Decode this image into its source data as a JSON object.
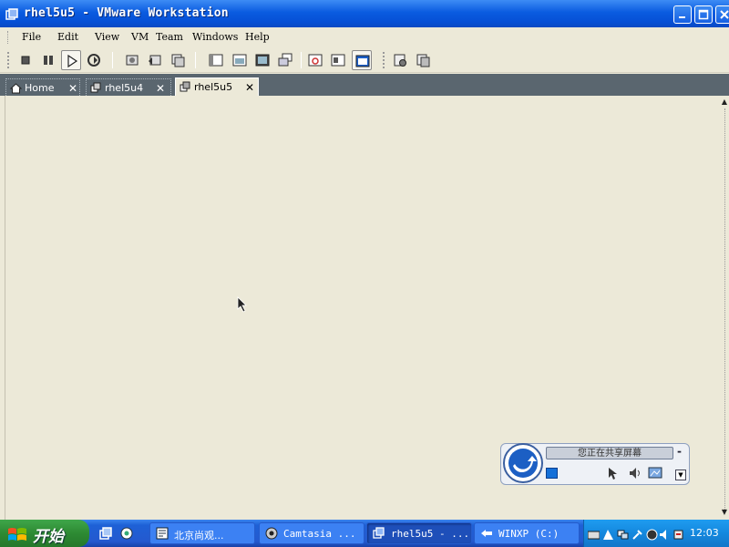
{
  "window": {
    "title": "rhel5u5 - VMware Workstation",
    "controls": [
      "minimize",
      "maximize",
      "close"
    ]
  },
  "menu": {
    "items": [
      "File",
      "Edit",
      "View",
      "VM",
      "Team",
      "Windows",
      "Help"
    ]
  },
  "toolbar": {
    "buttons": [
      "stop-icon",
      "pause-icon",
      "play-icon",
      "reset-icon",
      "snapshot-icon",
      "revert-snapshot-icon",
      "snapshot-manager-icon",
      "sidebar-icon",
      "quick-switch-icon",
      "fullscreen-icon",
      "unity-icon",
      "summary-icon",
      "appliance-view-icon",
      "console-view-icon",
      "settings-icon",
      "clone-icon"
    ],
    "active": [
      "play-icon",
      "console-view-icon"
    ]
  },
  "tabs": [
    {
      "label": "Home",
      "icon": "home-icon",
      "active": false
    },
    {
      "label": "rhel5u4",
      "icon": "vm-icon",
      "active": false
    },
    {
      "label": "rhel5u5",
      "icon": "vm-icon",
      "active": true
    }
  ],
  "share_widget": {
    "status_text": "您正在共享屏幕",
    "min_label": "-"
  },
  "taskbar": {
    "start_label": "开始",
    "tasks": [
      {
        "label": "北京尚观...",
        "icon": "ie-icon",
        "active": false
      },
      {
        "label": "Camtasia ...",
        "icon": "camtasia-icon",
        "active": false
      },
      {
        "label": "rhel5u5 - ...",
        "icon": "vmware-icon",
        "active": true
      },
      {
        "label": "WINXP (C:)",
        "icon": "drive-icon",
        "active": false
      }
    ],
    "clock": "12:03"
  },
  "colors": {
    "titlebar": "#0a5be0",
    "tabstrip": "#5a666f",
    "content_bg": "#ece9d8",
    "taskbar": "#245dd7",
    "start_button": "#2d8a33",
    "tray": "#1488de"
  }
}
